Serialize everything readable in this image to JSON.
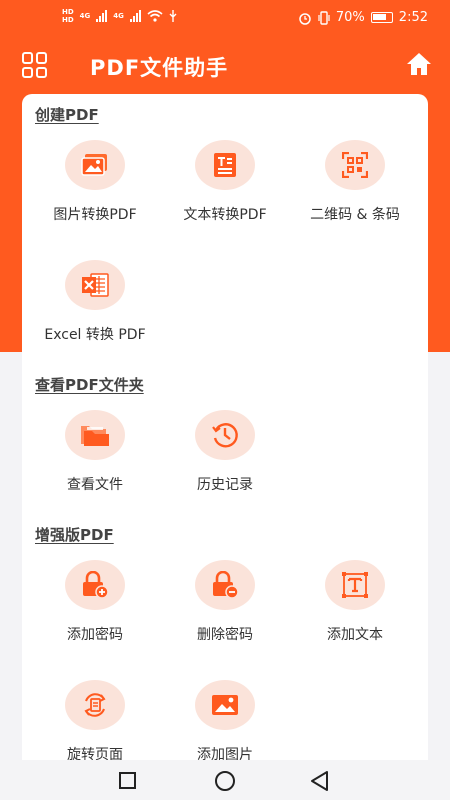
{
  "status_bar": {
    "hd1": "HD",
    "hd2": "HD",
    "net1": "4G",
    "net2": "4G",
    "battery": "70%",
    "time": "2:52"
  },
  "header": {
    "title": "PDF文件助手"
  },
  "sections": {
    "create": {
      "title": "创建PDF",
      "items": [
        "图片转换PDF",
        "文本转换PDF",
        "二维码 & 条码",
        "Excel 转换 PDF"
      ]
    },
    "view": {
      "title": "查看PDF文件夹",
      "items": [
        "查看文件",
        "历史记录"
      ]
    },
    "enhanced": {
      "title": "增强版PDF",
      "items": [
        "添加密码",
        "删除密码",
        "添加文本",
        "旋转页面",
        "添加图片"
      ]
    }
  },
  "colors": {
    "accent": "#ff5a1f",
    "icon_bg": "#fbe3da",
    "card": "#ffffff"
  }
}
